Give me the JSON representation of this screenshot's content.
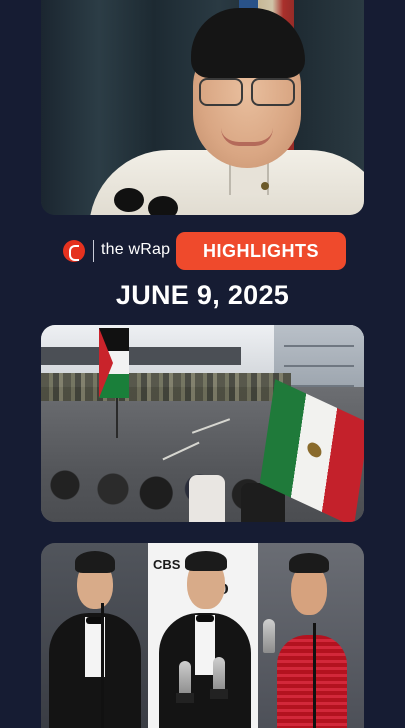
{
  "brand": {
    "name": "the wRap",
    "logo_icon": "rappler-logo-icon",
    "accent_color": "#e5321f"
  },
  "badge": {
    "label": "HIGHLIGHTS",
    "color": "#ef4a2c"
  },
  "date": "JUNE 9, 2025",
  "photo3": {
    "backdrop_text_1": "CBS",
    "backdrop_text_2": "TO"
  },
  "colors": {
    "background": "#161c33"
  }
}
